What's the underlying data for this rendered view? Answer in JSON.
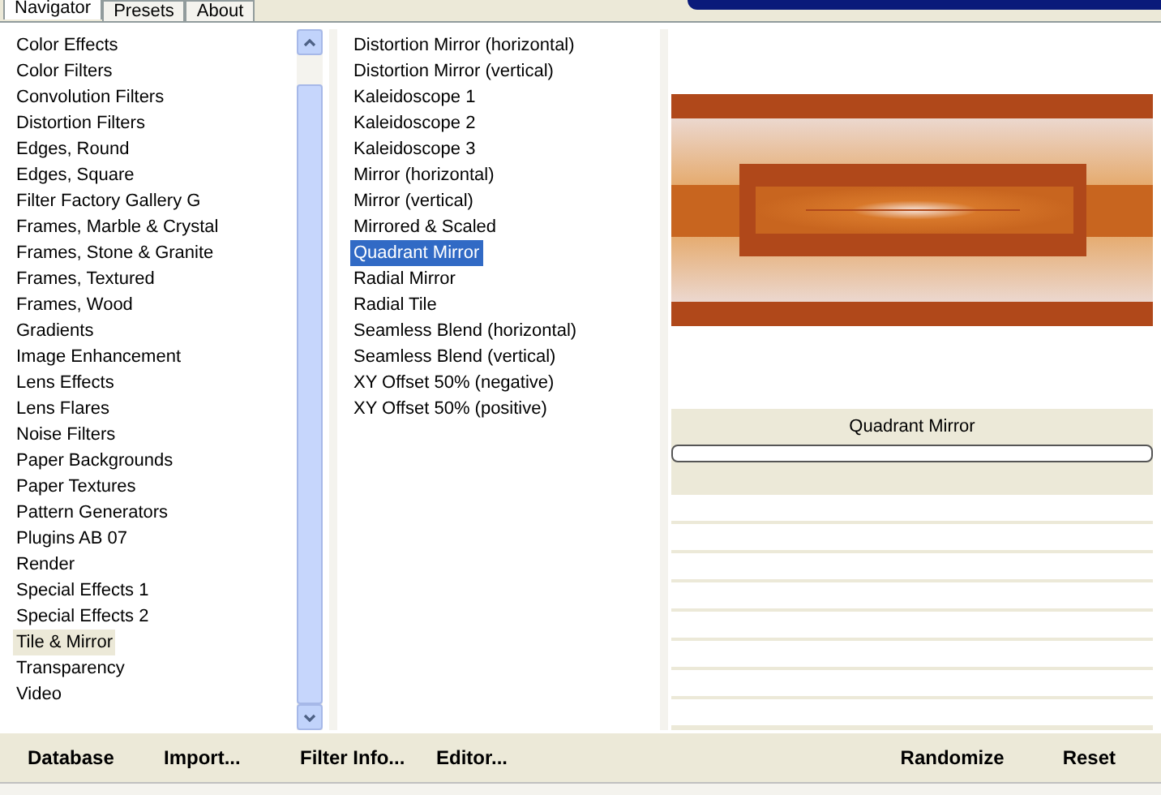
{
  "tabs": [
    {
      "label": "Navigator",
      "selected": true
    },
    {
      "label": "Presets",
      "selected": false
    },
    {
      "label": "About",
      "selected": false
    }
  ],
  "categories": [
    {
      "label": "Color Effects",
      "selected": false
    },
    {
      "label": "Color Filters",
      "selected": false
    },
    {
      "label": "Convolution Filters",
      "selected": false
    },
    {
      "label": "Distortion Filters",
      "selected": false
    },
    {
      "label": "Edges, Round",
      "selected": false
    },
    {
      "label": "Edges, Square",
      "selected": false
    },
    {
      "label": "Filter Factory Gallery G",
      "selected": false
    },
    {
      "label": "Frames, Marble & Crystal",
      "selected": false
    },
    {
      "label": "Frames, Stone & Granite",
      "selected": false
    },
    {
      "label": "Frames, Textured",
      "selected": false
    },
    {
      "label": "Frames, Wood",
      "selected": false
    },
    {
      "label": "Gradients",
      "selected": false
    },
    {
      "label": "Image Enhancement",
      "selected": false
    },
    {
      "label": "Lens Effects",
      "selected": false
    },
    {
      "label": "Lens Flares",
      "selected": false
    },
    {
      "label": "Noise Filters",
      "selected": false
    },
    {
      "label": "Paper Backgrounds",
      "selected": false
    },
    {
      "label": "Paper Textures",
      "selected": false
    },
    {
      "label": "Pattern Generators",
      "selected": false
    },
    {
      "label": "Plugins AB 07",
      "selected": false
    },
    {
      "label": "Render",
      "selected": false
    },
    {
      "label": "Special Effects 1",
      "selected": false
    },
    {
      "label": "Special Effects 2",
      "selected": false
    },
    {
      "label": "Tile & Mirror",
      "selected": true
    },
    {
      "label": "Transparency",
      "selected": false
    },
    {
      "label": "Video",
      "selected": false
    }
  ],
  "filters": [
    {
      "label": "Distortion Mirror (horizontal)",
      "selected": false
    },
    {
      "label": "Distortion Mirror (vertical)",
      "selected": false
    },
    {
      "label": "Kaleidoscope 1",
      "selected": false
    },
    {
      "label": "Kaleidoscope 2",
      "selected": false
    },
    {
      "label": "Kaleidoscope 3",
      "selected": false
    },
    {
      "label": "Mirror (horizontal)",
      "selected": false
    },
    {
      "label": "Mirror (vertical)",
      "selected": false
    },
    {
      "label": "Mirrored & Scaled",
      "selected": false
    },
    {
      "label": "Quadrant Mirror",
      "selected": true
    },
    {
      "label": "Radial Mirror",
      "selected": false
    },
    {
      "label": "Radial Tile",
      "selected": false
    },
    {
      "label": "Seamless Blend (horizontal)",
      "selected": false
    },
    {
      "label": "Seamless Blend (vertical)",
      "selected": false
    },
    {
      "label": "XY Offset 50% (negative)",
      "selected": false
    },
    {
      "label": "XY Offset 50% (positive)",
      "selected": false
    }
  ],
  "preview": {
    "filter_name": "Quadrant Mirror"
  },
  "bottom_left_buttons": [
    "Database",
    "Import...",
    "Filter Info...",
    "Editor..."
  ],
  "bottom_right_buttons": [
    "Randomize",
    "Reset"
  ]
}
